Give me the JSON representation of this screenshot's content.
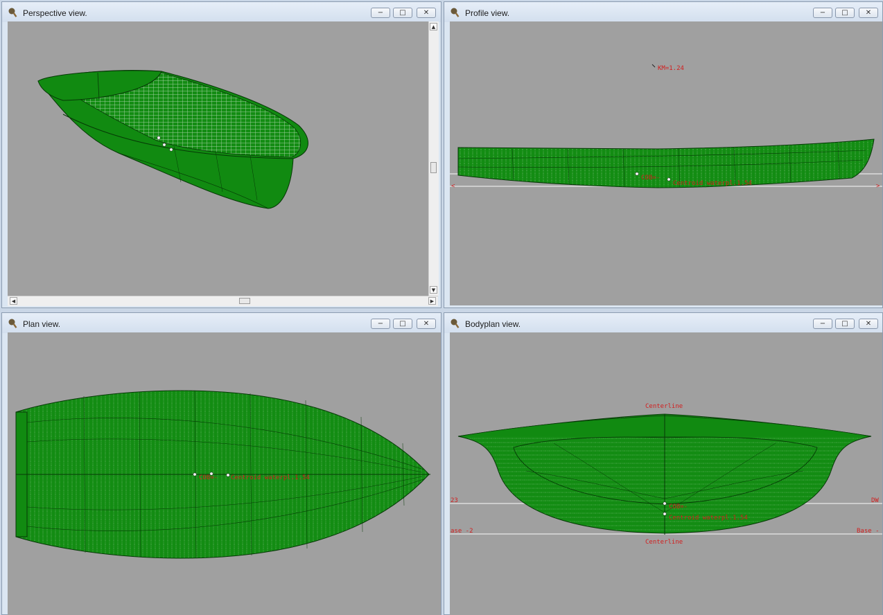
{
  "windows": {
    "perspective": {
      "title": "Perspective view."
    },
    "profile": {
      "title": "Profile view.",
      "km_label": "KM=1.24",
      "cob_label": "COB=-",
      "centroid_label": "Centroid waterpl.1.54",
      "marker_left": "<",
      "marker_right": ">"
    },
    "plan": {
      "title": "Plan view.",
      "cob_label": "COB=-",
      "centroid_label": "Centroid waterpl.1.54"
    },
    "bodyplan": {
      "title": "Bodyplan view.",
      "centerline_top": "Centerline",
      "centerline_bottom": "Centerline",
      "dwl_left": "23",
      "dwl_right": "DW",
      "base_left": "ase -2",
      "base_right": "Base -",
      "cob_label": "COB=-",
      "centroid_label": "Centroid waterpl.1.54"
    }
  },
  "window_buttons": {
    "minimize": "−",
    "maximize": "□",
    "close": "✕"
  },
  "scrollbar_glyphs": {
    "up": "▲",
    "down": "▼",
    "left": "◀",
    "right": "▶"
  },
  "colors": {
    "hull": "#118a11",
    "hull_dark": "#0c6e0c",
    "viewport_bg": "#a0a0a0",
    "label_red": "#d21e1e"
  }
}
